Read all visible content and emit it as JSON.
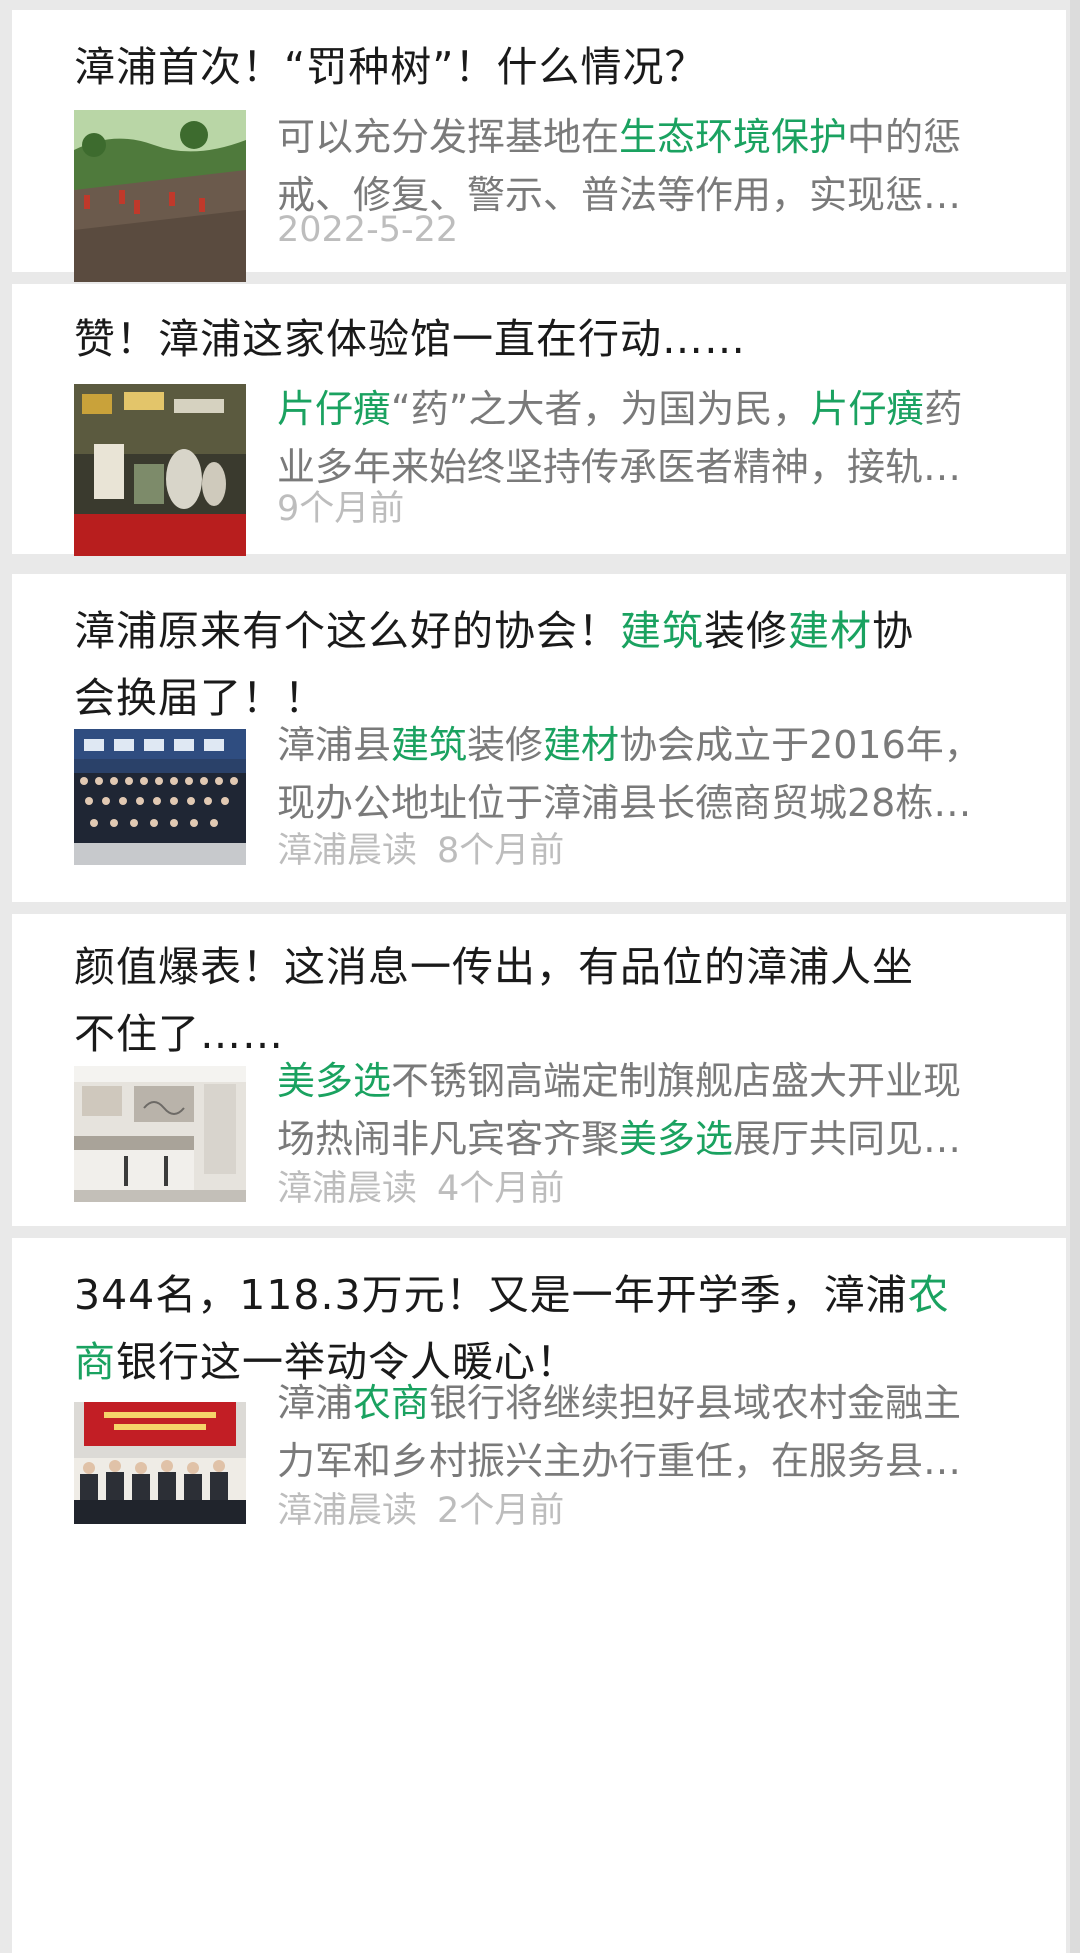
{
  "articles": [
    {
      "title": [
        "漳浦首次！“罚种树”！什么情况？"
      ],
      "desc_line1": [
        {
          "t": "可以充分发挥基地在",
          "h": false
        },
        {
          "t": "生态环境保护",
          "h": true
        },
        {
          "t": "中的惩",
          "h": false
        }
      ],
      "desc_line2": [
        {
          "t": "戒、修复、警示、普法等作用，实现惩…",
          "h": false
        }
      ],
      "source": "",
      "time": "2022-5-22",
      "thumb_icon": "hillside-tree-planting-photo"
    },
    {
      "title": [
        "赞！漳浦这家体验馆一直在行动……"
      ],
      "desc_line1": [
        {
          "t": "片仔癀",
          "h": true
        },
        {
          "t": "“药”之大者，为国为民，",
          "h": false
        },
        {
          "t": "片仔癀",
          "h": true
        },
        {
          "t": "药",
          "h": false
        }
      ],
      "desc_line2": [
        {
          "t": "业多年来始终坚持传承医者精神，接轨…",
          "h": false
        }
      ],
      "source": "",
      "time": "9个月前",
      "thumb_icon": "exhibition-display-photo"
    },
    {
      "title_line1": [
        {
          "t": "漳浦原来有个这么好的协会！",
          "h": false
        },
        {
          "t": "建筑",
          "h": true
        },
        {
          "t": "装修",
          "h": false
        },
        {
          "t": "建材",
          "h": true
        },
        {
          "t": "协",
          "h": false
        }
      ],
      "title_line2": [
        {
          "t": "会换届了！！",
          "h": false
        }
      ],
      "desc_line1": [
        {
          "t": "漳浦县",
          "h": false
        },
        {
          "t": "建筑",
          "h": true
        },
        {
          "t": "装修",
          "h": false
        },
        {
          "t": "建材",
          "h": true
        },
        {
          "t": "协会成立于2016年，",
          "h": false
        }
      ],
      "desc_line2": [
        {
          "t": "现办公地址位于漳浦县长德商贸城28栋…",
          "h": false
        }
      ],
      "source": "漳浦晨读",
      "time": "8个月前",
      "thumb_icon": "group-photo"
    },
    {
      "title_line1": [
        {
          "t": "颜值爆表！这消息一传出，有品位的漳浦人坐",
          "h": false
        }
      ],
      "title_line2": [
        {
          "t": "不住了……",
          "h": false
        }
      ],
      "desc_line1": [
        {
          "t": "美多选",
          "h": true
        },
        {
          "t": "不锈钢高端定制旗舰店盛大开业现",
          "h": false
        }
      ],
      "desc_line2": [
        {
          "t": "场热闹非凡宾客齐聚",
          "h": false
        },
        {
          "t": "美多选",
          "h": true
        },
        {
          "t": "展厅共同见…",
          "h": false
        }
      ],
      "source": "漳浦晨读",
      "time": "4个月前",
      "thumb_icon": "kitchen-showroom-photo"
    },
    {
      "title_line1": [
        {
          "t": "344名，118.3万元！又是一年开学季，漳浦",
          "h": false
        },
        {
          "t": "农",
          "h": true
        }
      ],
      "title_line2": [
        {
          "t": "商",
          "h": true
        },
        {
          "t": "银行这一举动令人暖心！",
          "h": false
        }
      ],
      "desc_line1": [
        {
          "t": "漳浦",
          "h": false
        },
        {
          "t": "农商",
          "h": true
        },
        {
          "t": "银行将继续担好县域农村金融主",
          "h": false
        }
      ],
      "desc_line2": [
        {
          "t": "力军和乡村振兴主办行重任，在服务县…",
          "h": false
        }
      ],
      "source": "漳浦晨读",
      "time": "2个月前",
      "thumb_icon": "conference-meeting-photo"
    }
  ]
}
